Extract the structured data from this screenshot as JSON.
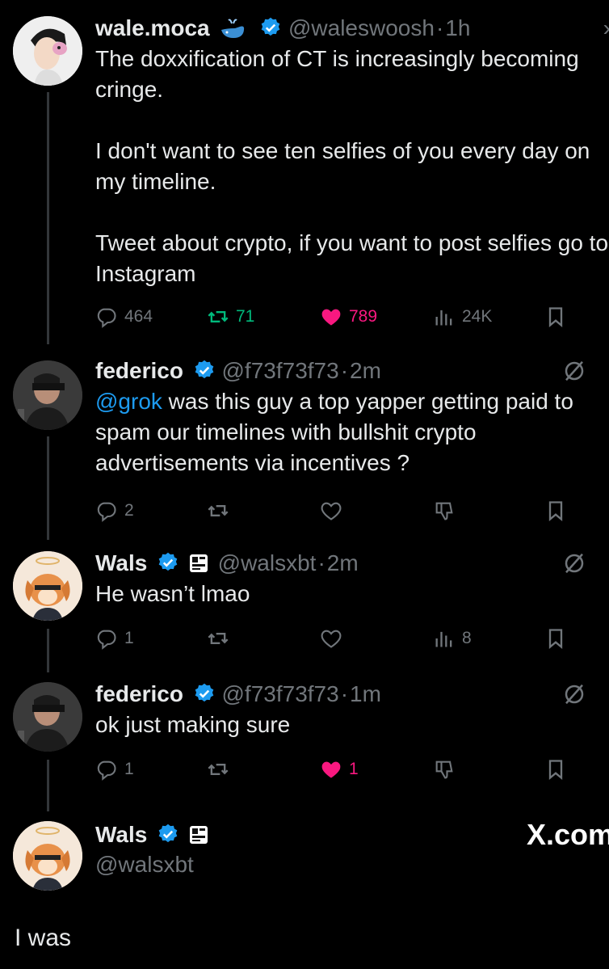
{
  "tweets": [
    {
      "name": "wale.moca",
      "handle": "@waleswoosh",
      "time": "1h",
      "text": "The doxxification of CT is increasingly becoming cringe.\n\nI don't want to see ten selfies of you every day on my timeline.\n\nTweet about crypto, if you want to post selfies go to Instagram",
      "replies": "464",
      "retweets": "71",
      "likes": "789",
      "views": "24K"
    },
    {
      "name": "federico",
      "handle": "@f73f73f73",
      "time": "2m",
      "mention": "@grok",
      "text": " was this guy a top yapper getting paid to spam our timelines with bullshit crypto advertisements via incentives ?",
      "replies": "2"
    },
    {
      "name": "Wals",
      "handle": "@walsxbt",
      "time": "2m",
      "text": "He wasn’t lmao",
      "replies": "1",
      "views": "8"
    },
    {
      "name": "federico",
      "handle": "@f73f73f73",
      "time": "1m",
      "text": "ok just making sure",
      "replies": "1",
      "likes": "1"
    }
  ],
  "quote_card": {
    "name": "Wals",
    "handle": "@walsxbt",
    "brand": "X.com"
  },
  "caption": "I was",
  "colors": {
    "accent_blue": "#1d9bf0",
    "like_pink": "#f91880",
    "retweet_green": "#00ba7c",
    "muted": "#71767b"
  },
  "icons": [
    "verified-icon",
    "whale-icon",
    "reply-icon",
    "retweet-icon",
    "like-icon",
    "views-icon",
    "bookmark-icon",
    "grok-icon",
    "dislike-icon",
    "more-icon"
  ]
}
